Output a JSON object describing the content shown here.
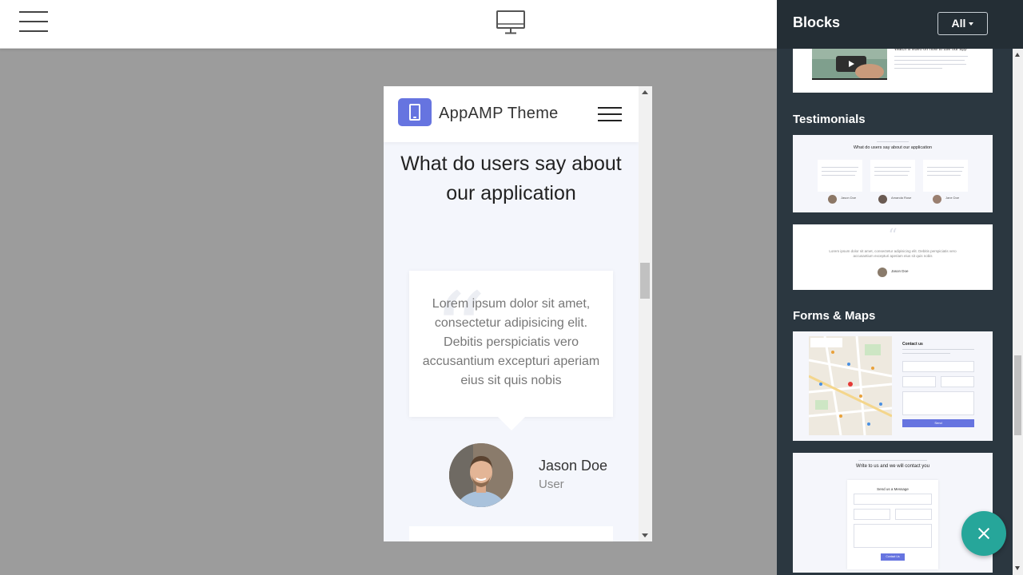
{
  "toolbar": {
    "menu_icon": "hamburger-icon",
    "view_icon": "desktop-monitor-icon"
  },
  "preview": {
    "site_title": "AppAMP Theme",
    "logo_icon": "tablet-icon",
    "menu_icon": "hamburger-icon",
    "section_heading": "What do users say about our application",
    "quote_mark": "“",
    "quote_text": "Lorem ipsum dolor sit amet, consectetur adipisicing elit. Debitis perspiciatis vero accusantium excepturi aperiam eius sit quis nobis",
    "author_name": "Jason Doe",
    "author_role": "User"
  },
  "panel": {
    "title": "Blocks",
    "filter_label": "All",
    "categories": [
      "Testimonials",
      "Forms & Maps"
    ],
    "thumb_video": {
      "title": "Watch a video on how to use our app"
    },
    "thumb_testimonials_1": {
      "title": "What do users say about our application",
      "names": [
        "Jason Doe",
        "Amanda Rose",
        "Jane Doe"
      ]
    },
    "thumb_testimonials_2": {
      "text": "Lorem ipsum dolor sit amet, consectetur adipisicing elit. Debitis perspiciatis vero accusantium excepturi aperiam eius sit quis nobis",
      "name": "Jason Doe"
    },
    "thumb_form_map": {
      "title": "Contact us",
      "button": "Send"
    },
    "thumb_form": {
      "title": "Write to us and we will contact you",
      "card_title": "Send us a Message",
      "button": "Contact Us"
    }
  },
  "fab": {
    "icon": "close-icon"
  },
  "colors": {
    "panel_bg": "#2b3740",
    "panel_header": "#242e35",
    "accent": "#6674e0",
    "fab": "#26a69a",
    "canvas_bg": "#9c9c9c"
  }
}
